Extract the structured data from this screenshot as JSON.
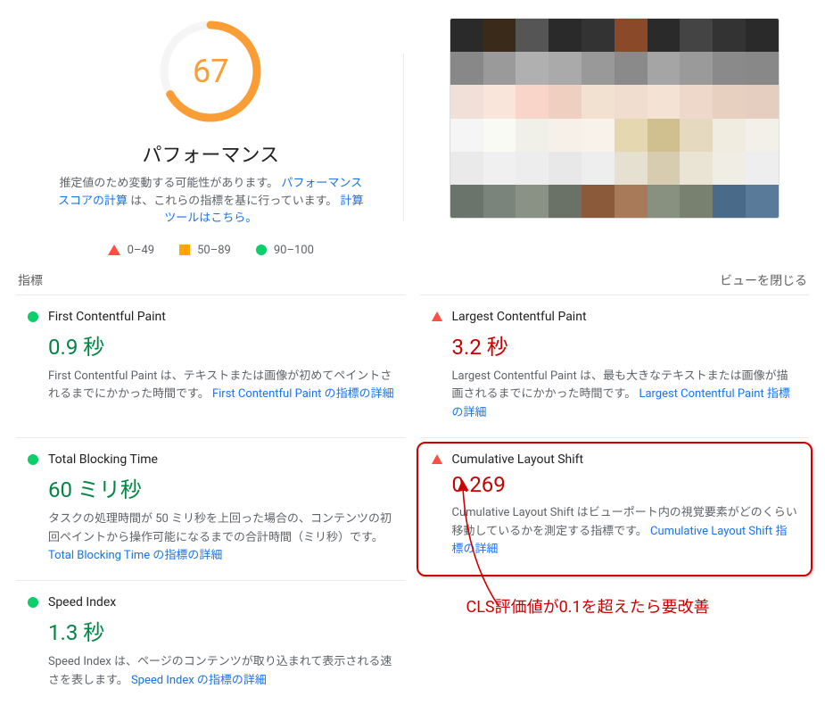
{
  "gauge": {
    "score": "67",
    "percent": 67
  },
  "perf": {
    "title": "パフォーマンス",
    "sub_prefix": "推定値のため変動する可能性があります。",
    "sub_link1": "パフォーマンス スコアの計算",
    "sub_mid": "は、これらの指標を基に行っています。",
    "sub_link2": "計算ツールはこちら。"
  },
  "legend": {
    "bad": "0–49",
    "mid": "50–89",
    "good": "90–100"
  },
  "header": {
    "metrics_label": "指標",
    "close_label": "ビューを閉じる"
  },
  "metrics": {
    "fcp": {
      "title": "First Contentful Paint",
      "value": "0.9 秒",
      "desc": "First Contentful Paint は、テキストまたは画像が初めてペイントされるまでにかかった時間です。",
      "link": "First Contentful Paint の指標の詳細"
    },
    "lcp": {
      "title": "Largest Contentful Paint",
      "value": "3.2 秒",
      "desc": "Largest Contentful Paint は、最も大きなテキストまたは画像が描画されるまでにかかった時間です。",
      "link": "Largest Contentful Paint 指標の詳細"
    },
    "tbt": {
      "title": "Total Blocking Time",
      "value": "60 ミリ秒",
      "desc": "タスクの処理時間が 50 ミリ秒を上回った場合の、コンテンツの初回ペイントから操作可能になるまでの合計時間（ミリ秒）です。",
      "link": "Total Blocking Time の指標の詳細"
    },
    "cls": {
      "title": "Cumulative Layout Shift",
      "value": "0.269",
      "desc": "Cumulative Layout Shift はビューポート内の視覚要素がどのくらい移動しているかを測定する指標です。",
      "link": "Cumulative Layout Shift 指標の詳細"
    },
    "si": {
      "title": "Speed Index",
      "value": "1.3 秒",
      "desc": "Speed Index は、ページのコンテンツが取り込まれて表示される速さを表します。",
      "link": "Speed Index の指標の詳細"
    }
  },
  "annotation": "CLS評価値が0.1を超えたら要改善"
}
